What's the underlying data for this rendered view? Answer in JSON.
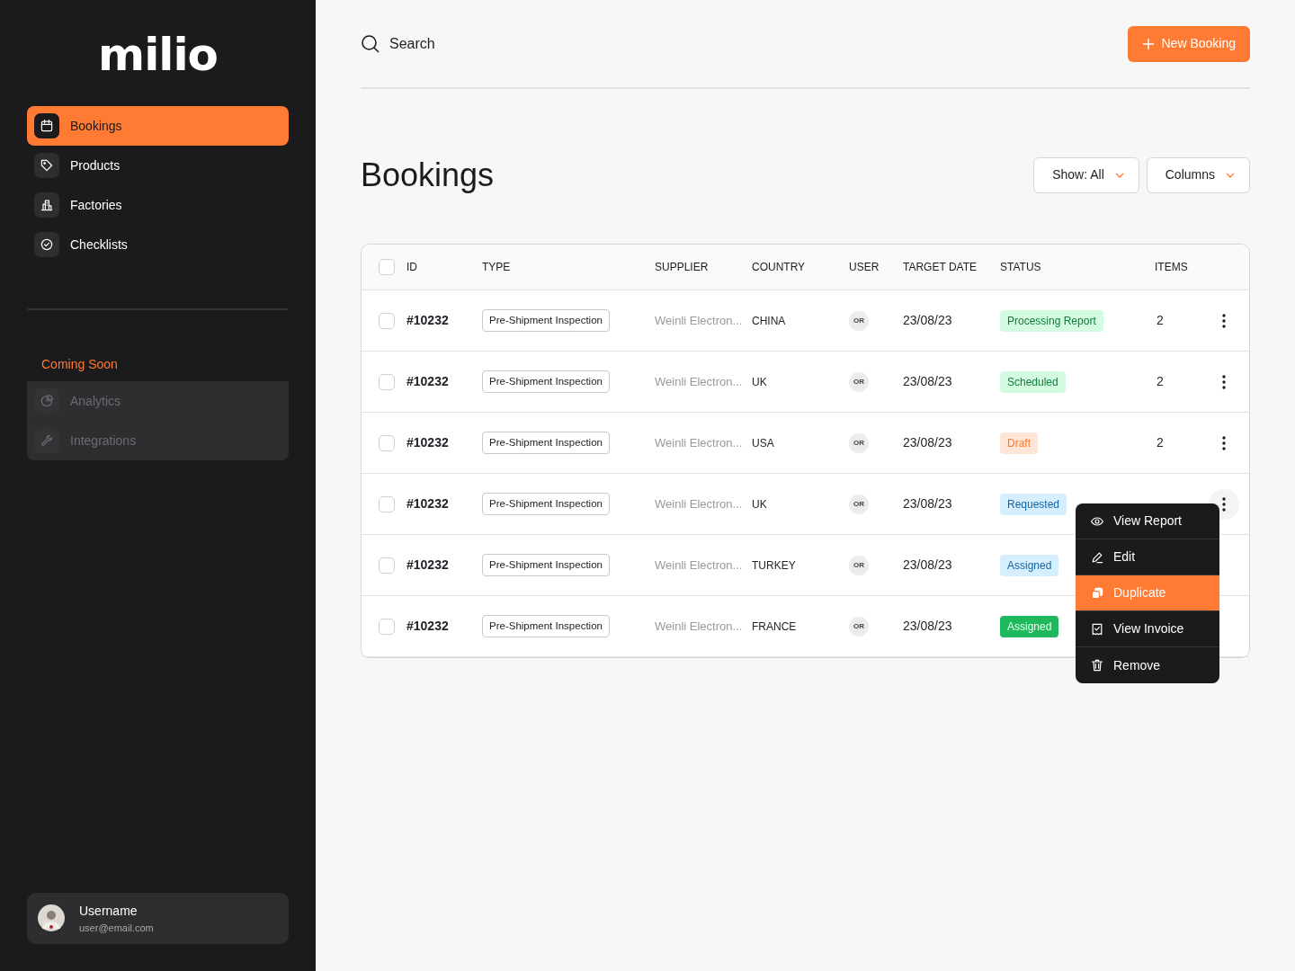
{
  "sidebar": {
    "logo": "milio",
    "nav": [
      {
        "label": "Bookings",
        "selected": true
      },
      {
        "label": "Products",
        "selected": false
      },
      {
        "label": "Factories",
        "selected": false
      },
      {
        "label": "Checklists",
        "selected": false
      }
    ],
    "coming_soon": {
      "title": "Coming Soon",
      "items": [
        {
          "label": "Analytics",
          "disabled": true
        },
        {
          "label": "Integrations",
          "disabled": true
        }
      ]
    },
    "user": {
      "name": "Username",
      "email": "user@email.com"
    }
  },
  "search": {
    "placeholder": "Search"
  },
  "new_button": "New Booking",
  "page_title": "Bookings",
  "filters": [
    "Show: All",
    "Columns"
  ],
  "table": {
    "select_all": {
      "checked": false
    },
    "columns": [
      "ID",
      "TYPE",
      "SUPPLIER",
      "COUNTRY",
      "USER",
      "TARGET DATE",
      "STATUS",
      "ITEMS"
    ],
    "rows": [
      {
        "checked": false,
        "id": "#10232",
        "type": "Pre-Shipment Inspection",
        "supplier": "Weinli Electron...",
        "country": "CHINA",
        "user": "OR",
        "date": "23/08/23",
        "status": {
          "label": "Processing Report",
          "color": "#d2fbe0"
        },
        "items": "2",
        "menu_button": true
      },
      {
        "checked": false,
        "id": "#10232",
        "type": "Pre-Shipment Inspection",
        "supplier": "Weinli Electron...",
        "country": "UK",
        "user": "OR",
        "date": "23/08/23",
        "status": {
          "label": "Scheduled",
          "color": "#d2fbe0"
        },
        "items": "2",
        "menu_button": true
      },
      {
        "checked": false,
        "id": "#10232",
        "type": "Pre-Shipment Inspection",
        "supplier": "Weinli Electron...",
        "country": "USA",
        "user": "OR",
        "date": "23/08/23",
        "status": {
          "label": "Draft",
          "color": "#ffe5d6"
        },
        "items": "2",
        "menu_button": true
      },
      {
        "checked": false,
        "id": "#10232",
        "type": "Pre-Shipment Inspection",
        "supplier": "Weinli Electron...",
        "country": "UK",
        "user": "OR",
        "date": "23/08/23",
        "status": {
          "label": "Requested",
          "color": "#d6efff"
        },
        "menu_button": true
      },
      {
        "checked": false,
        "id": "#10232",
        "type": "Pre-Shipment Inspection",
        "supplier": "Weinli Electron...",
        "country": "TURKEY",
        "user": "OR",
        "date": "23/08/23",
        "status": {
          "label": "Assigned",
          "color": "#d6efff"
        },
        "menu_button": false
      },
      {
        "checked": false,
        "id": "#10232",
        "type": "Pre-Shipment Inspection",
        "supplier": "Weinli Electron...",
        "country": "FRANCE",
        "user": "OR",
        "date": "23/08/23",
        "status": {
          "label": "Assigned",
          "color": "#1fb85c"
        },
        "menu_button": false
      }
    ]
  },
  "context_menu": {
    "items": [
      {
        "label": "View Report",
        "selected": false
      },
      {
        "label": "Edit",
        "selected": false
      },
      {
        "label": "Duplicate",
        "selected": true
      },
      {
        "label": "View Invoice",
        "selected": false
      },
      {
        "label": "Remove",
        "selected": false
      }
    ]
  }
}
